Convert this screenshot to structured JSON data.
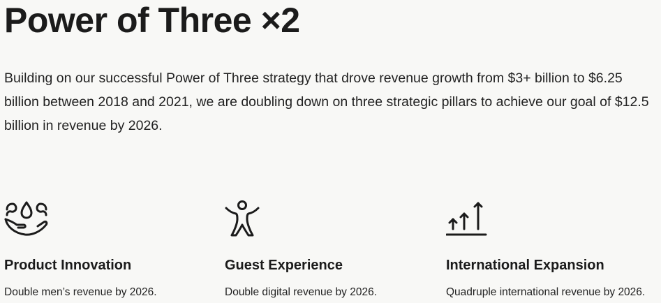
{
  "page": {
    "title": "Power of Three ×2",
    "intro": "Building on our successful Power of Three strategy that drove revenue growth from $3+ billion to $6.25 billion between 2018 and 2021, we are doubling down on three strategic pillars to achieve our goal of $12.5 billion in revenue by 2026."
  },
  "pillars": [
    {
      "icon": "droplets-in-hand-icon",
      "heading": "Product Innovation",
      "description": "Double men’s revenue by 2026."
    },
    {
      "icon": "person-arms-raised-icon",
      "heading": "Guest Experience",
      "description": "Double digital revenue by 2026."
    },
    {
      "icon": "growth-arrows-icon",
      "heading": "International Expansion",
      "description": "Quadruple international revenue by 2026."
    }
  ],
  "colors": {
    "background": "#f8f8f6",
    "text": "#1b1b1b"
  }
}
